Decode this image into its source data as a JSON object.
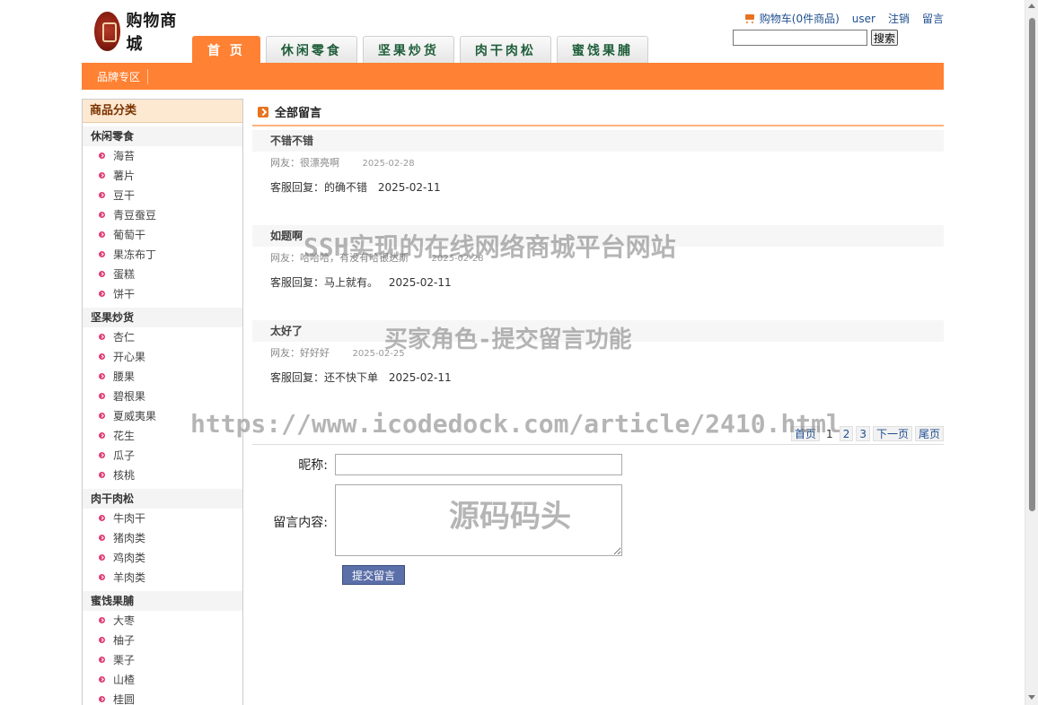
{
  "logo": {
    "text": "购物商城"
  },
  "topnav": {
    "cart_label": "购物车(0件商品)",
    "user": "user",
    "logout": "注销",
    "message": "留言"
  },
  "search": {
    "placeholder": "",
    "button": "搜索"
  },
  "tabs": [
    {
      "label": "首 页",
      "active": true
    },
    {
      "label": "休闲零食",
      "active": false
    },
    {
      "label": "坚果炒货",
      "active": false
    },
    {
      "label": "肉干肉松",
      "active": false
    },
    {
      "label": "蜜饯果脯",
      "active": false
    }
  ],
  "subnav": {
    "brand": "品牌专区"
  },
  "sidebar": {
    "title": "商品分类",
    "categories": [
      {
        "name": "休闲零食",
        "items": [
          "海苔",
          "薯片",
          "豆干",
          "青豆蚕豆",
          "葡萄干",
          "果冻布丁",
          "蛋糕",
          "饼干"
        ]
      },
      {
        "name": "坚果炒货",
        "items": [
          "杏仁",
          "开心果",
          "腰果",
          "碧根果",
          "夏威夷果",
          "花生",
          "瓜子",
          "核桃"
        ]
      },
      {
        "name": "肉干肉松",
        "items": [
          "牛肉干",
          "猪肉类",
          "鸡肉类",
          "羊肉类"
        ]
      },
      {
        "name": "蜜饯果脯",
        "items": [
          "大枣",
          "柚子",
          "栗子",
          "山楂",
          "桂圆"
        ]
      }
    ]
  },
  "main": {
    "title": "全部留言",
    "messages": [
      {
        "title": "不错不错",
        "meta": "网友：很漂亮啊",
        "date": "2025-02-28",
        "reply": "客服回复：的确不错",
        "reply_date": "2025-02-11"
      },
      {
        "title": "如题啊",
        "meta": "网友：哈哈哈，有没有哈银达斯",
        "date": "2025-02-28",
        "reply": "客服回复：马上就有。",
        "reply_date": "2025-02-11"
      },
      {
        "title": "太好了",
        "meta": "网友：好好好",
        "date": "2025-02-25",
        "reply": "客服回复：还不快下单",
        "reply_date": "2025-02-11"
      }
    ],
    "pager": {
      "first": "首页",
      "pages": [
        "1",
        "2",
        "3"
      ],
      "current": "1",
      "next": "下一页",
      "last": "尾页"
    },
    "form": {
      "nickname_label": "昵称:",
      "nickname_value": "",
      "content_label": "留言内容:",
      "content_value": "",
      "submit": "提交留言"
    }
  },
  "watermarks": {
    "w1": "SSH实现的在线网络商城平台网站",
    "w2": "买家角色-提交留言功能",
    "w3": "https://www.icodedock.com/article/2410.html",
    "w4": "源码码头"
  },
  "colors": {
    "accent": "#ff8133",
    "link": "#1f4f8f",
    "bullet": "#e23a75"
  }
}
